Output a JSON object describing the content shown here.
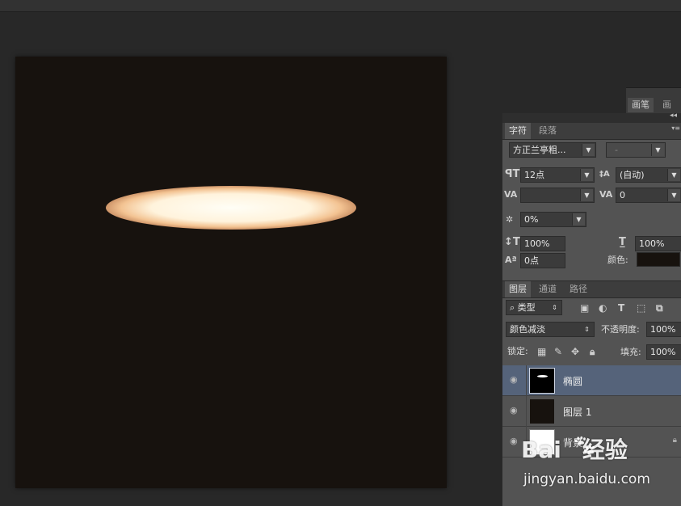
{
  "brush_tabs": [
    "画笔",
    "画笔"
  ],
  "character": {
    "tabs": [
      "字符",
      "段落"
    ],
    "font_family": "方正兰亭粗...",
    "font_style": "-",
    "size": "12点",
    "leading": "(自动)",
    "kerning": "",
    "tracking": "0",
    "scale_percent": "0%",
    "vertical_scale": "100%",
    "horizontal_scale": "100%",
    "baseline_shift": "0点",
    "color_label": "颜色:",
    "color": "#17120e"
  },
  "layers": {
    "tabs": [
      "图层",
      "通道",
      "路径"
    ],
    "filter_label": "类型",
    "blend_mode": "颜色减淡",
    "opacity_label": "不透明度:",
    "opacity": "100%",
    "lock_label": "锁定:",
    "fill_label": "填充:",
    "fill": "100%",
    "items": [
      {
        "name": "椭圆",
        "selected": true
      },
      {
        "name": "图层 1",
        "selected": false
      },
      {
        "name": "背景",
        "selected": false,
        "locked": true
      }
    ]
  },
  "watermark": {
    "brand": "Bai",
    "brand2": "经验",
    "url": "jingyan.baidu.com"
  },
  "colors": {
    "canvas": "#17120e",
    "panel": "#535353",
    "selected_layer": "#55637a"
  }
}
